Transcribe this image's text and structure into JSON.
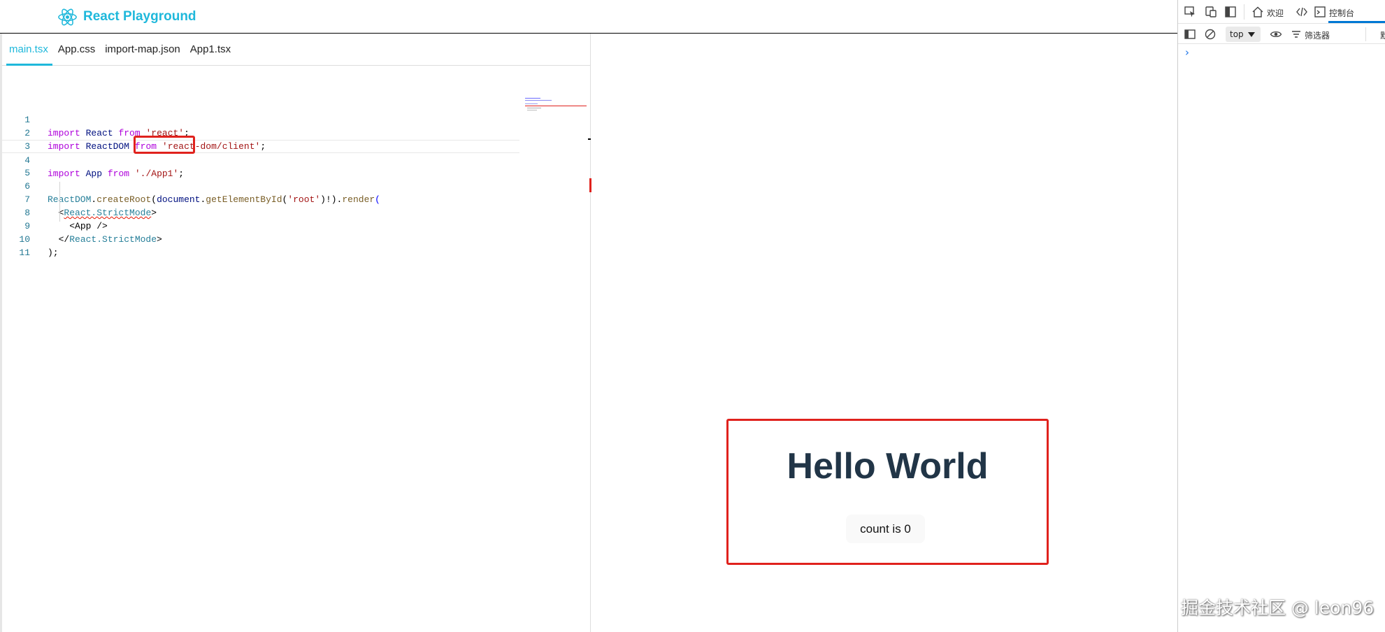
{
  "header": {
    "app_title": "React Playground",
    "logo_icon": "react-atom-icon",
    "accent": "#1fb8db"
  },
  "editor": {
    "tabs": [
      {
        "label": "main.tsx",
        "active": true
      },
      {
        "label": "App.css",
        "active": false
      },
      {
        "label": "import-map.json",
        "active": false
      },
      {
        "label": "App1.tsx",
        "active": false
      }
    ],
    "line_numbers": [
      "1",
      "2",
      "3",
      "4",
      "5",
      "6",
      "7",
      "8",
      "9",
      "10",
      "11"
    ],
    "code": {
      "l1": {
        "import": "import",
        "name": "React",
        "from": "from",
        "path": "'react'",
        "end": ";"
      },
      "l2": {
        "import": "import",
        "name": "ReactDOM",
        "from": "from",
        "path": "'react-dom/client'",
        "end": ";"
      },
      "l4": {
        "import": "import",
        "name": "App",
        "from": "from",
        "path": "'./App1'",
        "end": ";"
      },
      "l6": {
        "obj": "ReactDOM",
        "dot1": ".",
        "fn1": "createRoot",
        "p1": "(",
        "doc": "document",
        "dot2": ".",
        "fn2": "getElementById",
        "p2": "(",
        "arg": "'root'",
        "p3": ")!)",
        "dot3": ".",
        "fn3": "render",
        "p4": "("
      },
      "l7": {
        "lt": "<",
        "tag": "React.StrictMode",
        "gt": ">"
      },
      "l8": {
        "text": "<App />"
      },
      "l9": {
        "lt": "</",
        "tag": "React.StrictMode",
        "gt": ">"
      },
      "l10": {
        "text": ");"
      }
    },
    "error_color": "#e0221d"
  },
  "preview": {
    "heading": "Hello World",
    "button_label": "count is 0"
  },
  "devtools": {
    "tabs": [
      {
        "label": "欢迎",
        "icon": "home-icon"
      },
      {
        "label": "",
        "icon": "code-brackets-icon"
      },
      {
        "label": "控制台",
        "icon": "console-icon",
        "active": true
      }
    ],
    "context_select": "top",
    "filter_label": "筛选器",
    "prompt_symbol": "›",
    "cut_off_label": "默"
  },
  "watermark": "掘金技术社区 @ leon96"
}
